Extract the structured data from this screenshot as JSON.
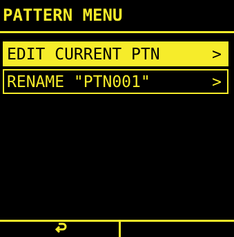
{
  "screen": {
    "title": "PATTERN MENU",
    "colors": {
      "foreground": "#f6ec2a",
      "background": "#000000"
    }
  },
  "menu": {
    "items": [
      {
        "label": "EDIT CURRENT PTN",
        "arrow": ">",
        "selected": true
      },
      {
        "label": "RENAME \"PTN001\"",
        "arrow": ">",
        "selected": false
      }
    ]
  },
  "softkeys": {
    "left": {
      "icon": "return-icon"
    },
    "right": {
      "icon": ""
    }
  }
}
